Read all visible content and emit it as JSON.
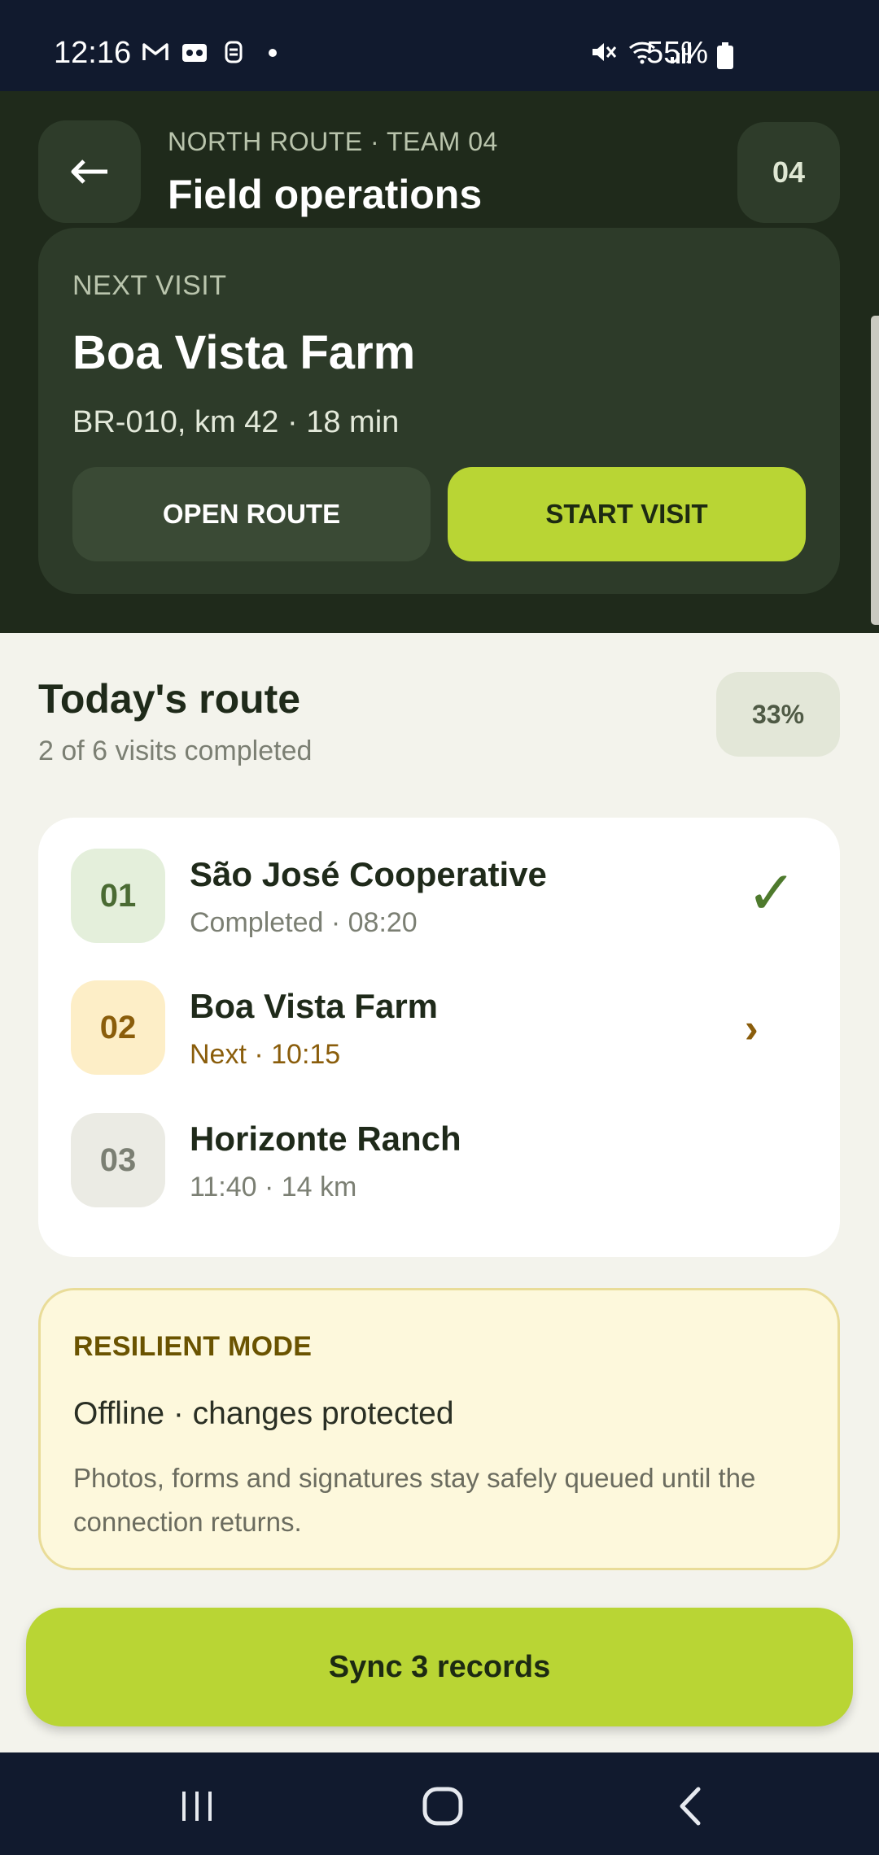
{
  "status_bar": {
    "time": "12:16",
    "battery": "55%",
    "left_icons": [
      "gmail-icon",
      "voicemail-icon",
      "notification-icon",
      "dot-icon"
    ],
    "right_icons": [
      "mute-icon",
      "wifi-icon",
      "signal-icon",
      "battery-icon"
    ]
  },
  "header": {
    "route_meta": "NORTH ROUTE · TEAM 04",
    "title": "Field operations",
    "team_badge": "04",
    "back_icon": "arrow-left-icon"
  },
  "next_visit": {
    "label": "NEXT VISIT",
    "name": "Boa Vista Farm",
    "detail": "BR-010, km 42 · 18 min",
    "open_route_label": "OPEN ROUTE",
    "start_visit_label": "START VISIT"
  },
  "today": {
    "title": "Today's route",
    "subtitle": "2 of 6 visits completed",
    "progress_badge": "33%",
    "progress_value": 33
  },
  "visits": [
    {
      "number": "01",
      "name": "São José Cooperative",
      "sub": "Completed · 08:20",
      "state": "done",
      "trailing": "✓"
    },
    {
      "number": "02",
      "name": "Boa Vista Farm",
      "sub": "Next · 10:15",
      "state": "next",
      "trailing": "›"
    },
    {
      "number": "03",
      "name": "Horizonte Ranch",
      "sub": "11:40 · 14 km",
      "state": "todo",
      "trailing": ""
    }
  ],
  "resilient": {
    "label": "RESILIENT MODE",
    "status": "Offline · changes protected",
    "description": "Photos, forms and signatures stay safely queued until the connection returns."
  },
  "sync_button": "Sync 3 records",
  "colors": {
    "status_bar_bg": "#111a2e",
    "header_bg": "#1f2a1b",
    "card_bg": "#2d3b29",
    "accent_lime": "#b9d534",
    "page_bg": "#f3f3ec",
    "done_green": "#4e7a2d",
    "next_amber": "#8a5d0b"
  },
  "nav_bar": [
    "recent-apps-icon",
    "home-icon",
    "back-icon"
  ]
}
